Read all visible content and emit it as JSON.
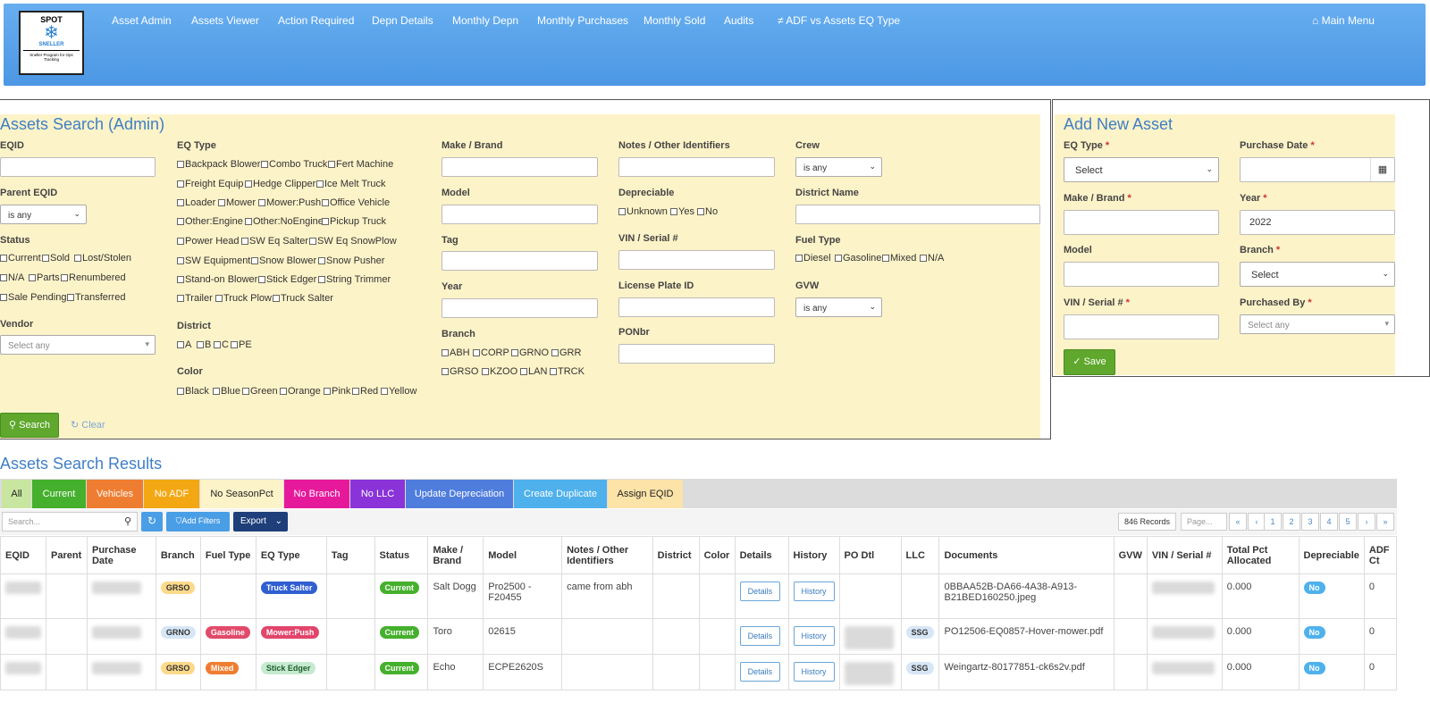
{
  "app": {
    "logo_title": "SPOT",
    "logo_brand": "SNELLER",
    "logo_tagline": "Sneller Program for Ops Tracking"
  },
  "nav": {
    "items": [
      "Asset Admin",
      "Assets Viewer",
      "Action Required",
      "Depn Details",
      "Monthly Depn",
      "Monthly Purchases",
      "Monthly Sold",
      "Audits",
      "ADF vs Assets EQ Type"
    ],
    "main_menu": "Main Menu"
  },
  "search": {
    "title": "Assets Search (Admin)",
    "eqid_label": "EQID",
    "parent_label": "Parent EQID",
    "parent_value": "is any",
    "status_label": "Status",
    "status_options": [
      "Current",
      "Sold",
      "Lost/Stolen",
      "N/A",
      "Parts",
      "Renumbered",
      "Sale Pending",
      "Transferred"
    ],
    "vendor_label": "Vendor",
    "vendor_placeholder": "Select any",
    "eqtype_label": "EQ Type",
    "eqtype_options": [
      "Backpack Blower",
      "Combo Truck",
      "Fert Machine",
      "Freight Equip",
      "Hedge Clipper",
      "Ice Melt Truck",
      "Loader",
      "Mower",
      "Mower:Push",
      "Office Vehicle",
      "Other:Engine",
      "Other:NoEngine",
      "Pickup Truck",
      "Power Head",
      "SW Eq Salter",
      "SW Eq SnowPlow",
      "SW Equipment",
      "Snow Blower",
      "Snow Pusher",
      "Stand-on Blower",
      "Stick Edger",
      "String Trimmer",
      "Trailer",
      "Truck Plow",
      "Truck Salter"
    ],
    "district_label": "District",
    "district_options": [
      "A",
      "B",
      "C",
      "PE"
    ],
    "color_label": "Color",
    "color_options": [
      "Black",
      "Blue",
      "Green",
      "Orange",
      "Pink",
      "Red",
      "Yellow"
    ],
    "make_label": "Make / Brand",
    "model_label": "Model",
    "tag_label": "Tag",
    "year_label": "Year",
    "branch_label": "Branch",
    "branch_options": [
      "ABH",
      "CORP",
      "GRNO",
      "GRR",
      "GRSO",
      "KZOO",
      "LAN",
      "TRCK"
    ],
    "notes_label": "Notes / Other Identifiers",
    "depreciable_label": "Depreciable",
    "depreciable_options": [
      "Unknown",
      "Yes",
      "No"
    ],
    "vin_label": "VIN / Serial #",
    "license_label": "License Plate ID",
    "ponbr_label": "PONbr",
    "crew_label": "Crew",
    "crew_value": "is any",
    "district_name_label": "District Name",
    "fuel_label": "Fuel Type",
    "fuel_options": [
      "Diesel",
      "Gasoline",
      "Mixed",
      "N/A"
    ],
    "gvw_label": "GVW",
    "gvw_value": "is any",
    "search_btn": "Search",
    "clear_btn": "Clear"
  },
  "add": {
    "title": "Add New Asset",
    "eqtype_label": "EQ Type",
    "eqtype_value": "Select",
    "purchase_date_label": "Purchase Date",
    "make_label": "Make / Brand",
    "year_label": "Year",
    "year_value": "2022",
    "model_label": "Model",
    "branch_label": "Branch",
    "branch_value": "Select",
    "vin_label": "VIN / Serial #",
    "purchased_by_label": "Purchased By",
    "purchased_by_placeholder": "Select any",
    "save_btn": "Save",
    "req": "*"
  },
  "results": {
    "title": "Assets Search Results",
    "tabs": [
      {
        "label": "All",
        "color": "#c8e6a0",
        "text": "#222"
      },
      {
        "label": "Current",
        "color": "#45b02d",
        "text": "#fff"
      },
      {
        "label": "Vehicles",
        "color": "#ef7d31",
        "text": "#fff"
      },
      {
        "label": "No ADF",
        "color": "#f3a813",
        "text": "#fff"
      },
      {
        "label": "No SeasonPct",
        "color": "#fdf3c8",
        "text": "#222"
      },
      {
        "label": "No Branch",
        "color": "#e7199b",
        "text": "#fff"
      },
      {
        "label": "No LLC",
        "color": "#8a33d8",
        "text": "#fff"
      },
      {
        "label": "Update Depreciation",
        "color": "#4f7ddd",
        "text": "#fff"
      },
      {
        "label": "Create Duplicate",
        "color": "#4fb1ec",
        "text": "#fff"
      },
      {
        "label": "Assign EQID",
        "color": "#fce3a8",
        "text": "#222"
      }
    ],
    "search_placeholder": "Search...",
    "add_filters": "Add Filters",
    "export": "Export",
    "record_count": "846 Records",
    "page_placeholder": "Page...",
    "pages": [
      "«",
      "‹",
      "1",
      "2",
      "3",
      "4",
      "5",
      "›",
      "»"
    ],
    "columns": [
      "EQID",
      "Parent",
      "Purchase Date",
      "Branch",
      "Fuel Type",
      "EQ Type",
      "Tag",
      "Status",
      "Make / Brand",
      "Model",
      "Notes / Other Identifiers",
      "District",
      "Color",
      "Details",
      "History",
      "PO Dtl",
      "LLC",
      "Documents",
      "GVW",
      "VIN / Serial #",
      "Total Pct Allocated",
      "Depreciable",
      "ADF Ct"
    ],
    "rows": [
      {
        "branch": "GRSO",
        "branch_color": "#fdd98a",
        "fuel": "",
        "fuel_color": "",
        "eqtype": "Truck Salter",
        "eqtype_color": "#2f5fd1",
        "status": "Current",
        "make": "Salt Dogg",
        "model": "Pro2500 - F20455",
        "notes": "came from abh",
        "details": "Details",
        "history": "History",
        "llc": "",
        "document": "0BBAA52B-DA66-4A38-A913-B21BED160250.jpeg",
        "pct": "0.000",
        "depreciable": "No",
        "adf": "0"
      },
      {
        "branch": "GRNO",
        "branch_color": "#d6e6f6",
        "fuel": "Gasoline",
        "fuel_color": "#e24a6b",
        "eqtype": "Mower:Push",
        "eqtype_color": "#e2456b",
        "status": "Current",
        "make": "Toro",
        "model": "02615",
        "notes": "",
        "details": "Details",
        "history": "History",
        "llc": "SSG",
        "document": "PO12506-EQ0857-Hover-mower.pdf",
        "pct": "0.000",
        "depreciable": "No",
        "adf": "0"
      },
      {
        "branch": "GRSO",
        "branch_color": "#fdd98a",
        "fuel": "Mixed",
        "fuel_color": "#ef7d31",
        "eqtype": "Stick Edger",
        "eqtype_color": "#c6ead0",
        "status": "Current",
        "make": "Echo",
        "model": "ECPE2620S",
        "notes": "",
        "details": "Details",
        "history": "History",
        "llc": "SSG",
        "document": "Weingartz-80177851-ck6s2v.pdf",
        "pct": "0.000",
        "depreciable": "No",
        "adf": "0"
      }
    ],
    "status_color": "#45b02d",
    "depreciable_color": "#4fb1ec"
  }
}
